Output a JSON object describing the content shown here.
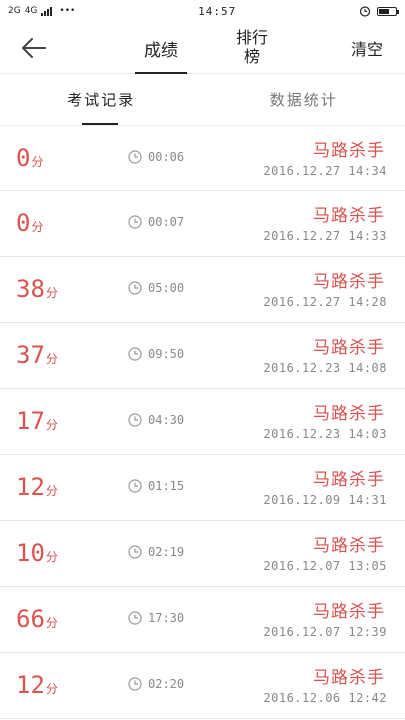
{
  "status_bar": {
    "network_left": "2G",
    "network_mid": "4G",
    "time": "14:57",
    "more": "•••"
  },
  "nav": {
    "back_icon": "back-arrow-icon",
    "tab_active": "成绩",
    "tab_rank": "排行榜",
    "clear": "清空"
  },
  "sub_tabs": {
    "records": "考试记录",
    "stats": "数据统计"
  },
  "colors": {
    "accent": "#d9534f",
    "muted": "#888888"
  },
  "records": [
    {
      "score": "0",
      "unit": "分",
      "duration": "00:06",
      "player": "马路杀手",
      "date": "2016.12.27 14:34"
    },
    {
      "score": "0",
      "unit": "分",
      "duration": "00:07",
      "player": "马路杀手",
      "date": "2016.12.27 14:33"
    },
    {
      "score": "38",
      "unit": "分",
      "duration": "05:00",
      "player": "马路杀手",
      "date": "2016.12.27 14:28"
    },
    {
      "score": "37",
      "unit": "分",
      "duration": "09:50",
      "player": "马路杀手",
      "date": "2016.12.23 14:08"
    },
    {
      "score": "17",
      "unit": "分",
      "duration": "04:30",
      "player": "马路杀手",
      "date": "2016.12.23 14:03"
    },
    {
      "score": "12",
      "unit": "分",
      "duration": "01:15",
      "player": "马路杀手",
      "date": "2016.12.09 14:31"
    },
    {
      "score": "10",
      "unit": "分",
      "duration": "02:19",
      "player": "马路杀手",
      "date": "2016.12.07 13:05"
    },
    {
      "score": "66",
      "unit": "分",
      "duration": "17:30",
      "player": "马路杀手",
      "date": "2016.12.07 12:39"
    },
    {
      "score": "12",
      "unit": "分",
      "duration": "02:20",
      "player": "马路杀手",
      "date": "2016.12.06 12:42"
    }
  ]
}
